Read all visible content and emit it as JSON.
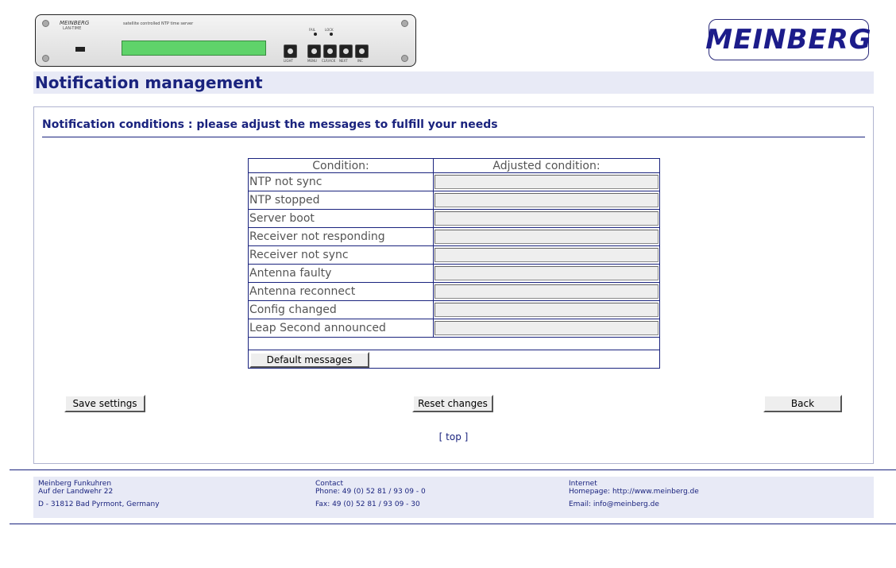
{
  "device": {
    "brand": "MEINBERG",
    "model": "LAN-TIME",
    "description": "satellite controlled NTP time server",
    "buttons": [
      "LIGHT",
      "MENU",
      "CLR/ACK",
      "NEXT",
      "INC"
    ],
    "leds": [
      "FAIL",
      "LOCK"
    ]
  },
  "logo": {
    "text": "MEINBERG"
  },
  "page": {
    "title": "Notification management"
  },
  "section": {
    "title": "Notification conditions : please adjust the messages to fulfill your needs"
  },
  "table": {
    "headers": {
      "condition": "Condition:",
      "adjusted": "Adjusted condition:"
    },
    "rows": [
      {
        "condition": "NTP not sync",
        "value": ""
      },
      {
        "condition": "NTP stopped",
        "value": ""
      },
      {
        "condition": "Server boot",
        "value": ""
      },
      {
        "condition": "Receiver not responding",
        "value": ""
      },
      {
        "condition": "Receiver not sync",
        "value": ""
      },
      {
        "condition": "Antenna faulty",
        "value": ""
      },
      {
        "condition": "Antenna reconnect",
        "value": ""
      },
      {
        "condition": "Config changed",
        "value": ""
      },
      {
        "condition": "Leap Second announced",
        "value": ""
      }
    ],
    "default_button": "Default messages"
  },
  "actions": {
    "save": "Save settings",
    "reset": "Reset changes",
    "back": "Back",
    "top_link": "[ top ]"
  },
  "footer": {
    "company": {
      "line1": "Meinberg Funkuhren",
      "line2": "Auf der Landwehr 22",
      "line3": "D - 31812 Bad Pyrmont, Germany"
    },
    "contact": {
      "line1": "Contact",
      "line2": "Phone: 49 (0) 52 81 / 93 09 - 0",
      "line3": "Fax: 49 (0) 52 81 / 93 09 - 30"
    },
    "internet": {
      "line1": "Internet",
      "line2": "Homepage: http://www.meinberg.de",
      "line3": "Email: info@meinberg.de"
    }
  },
  "colors": {
    "accent": "#1a237e",
    "band": "#e8eaf6",
    "lcd": "#5fd36a"
  }
}
